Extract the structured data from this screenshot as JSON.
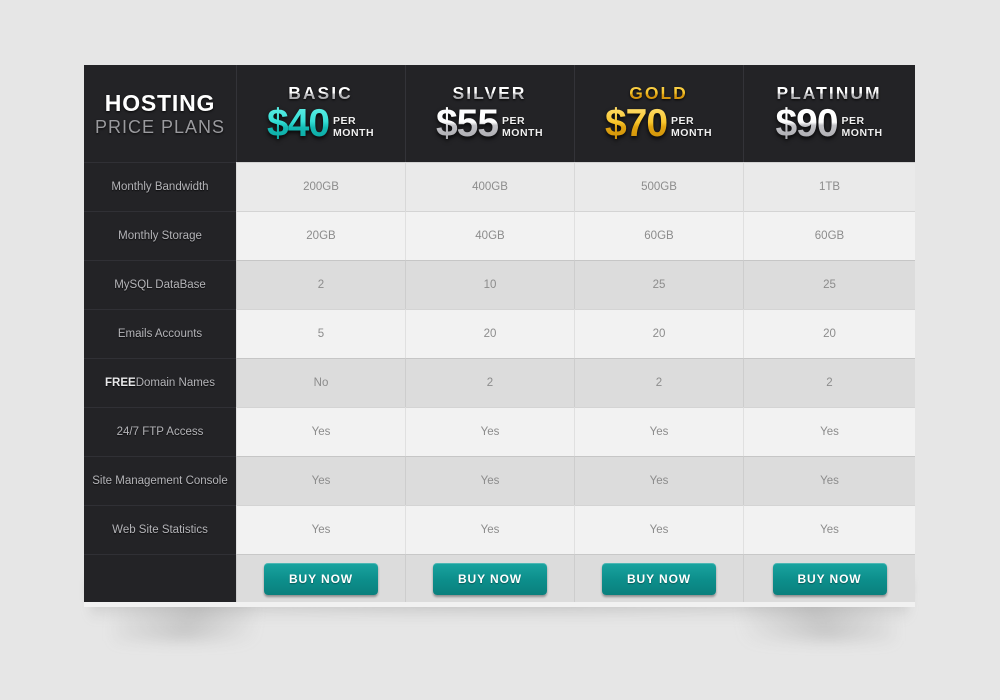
{
  "brand": {
    "line1": "HOSTING",
    "line2": "PRICE PLANS"
  },
  "colors": {
    "page_background": "#e6e6e6",
    "header_dark": "#232326",
    "feature_column_dark": "#232326",
    "row_light": "#f2f2f2",
    "row_dark": "#dcdcdc",
    "row_first": "#eaeaea",
    "accent_teal": "#13b9b3",
    "accent_gold": "#f5c32a",
    "accent_silver": "#c2c2c6",
    "button_teal": "#0d8f8c"
  },
  "plans": [
    {
      "name": "BASIC",
      "price": "$40",
      "per_line1": "PER",
      "per_line2": "MONTH",
      "name_style": "silver",
      "price_style": "teal",
      "buy_label": "BUY NOW"
    },
    {
      "name": "SILVER",
      "price": "$55",
      "per_line1": "PER",
      "per_line2": "MONTH",
      "name_style": "silver",
      "price_style": "silver",
      "buy_label": "BUY NOW"
    },
    {
      "name": "GOLD",
      "price": "$70",
      "per_line1": "PER",
      "per_line2": "MONTH",
      "name_style": "gold",
      "price_style": "gold",
      "buy_label": "BUY NOW"
    },
    {
      "name": "PLATINUM",
      "price": "$90",
      "per_line1": "PER",
      "per_line2": "MONTH",
      "name_style": "silver",
      "price_style": "silver",
      "buy_label": "BUY NOW"
    }
  ],
  "features": [
    {
      "label": "Monthly Bandwidth",
      "label_bold_prefix": "",
      "values": [
        "200GB",
        "400GB",
        "500GB",
        "1TB"
      ]
    },
    {
      "label": "Monthly Storage",
      "label_bold_prefix": "",
      "values": [
        "20GB",
        "40GB",
        "60GB",
        "60GB"
      ]
    },
    {
      "label": "MySQL DataBase",
      "label_bold_prefix": "",
      "values": [
        "2",
        "10",
        "25",
        "25"
      ]
    },
    {
      "label": "Emails Accounts",
      "label_bold_prefix": "",
      "values": [
        "5",
        "20",
        "20",
        "20"
      ]
    },
    {
      "label": " Domain Names",
      "label_bold_prefix": "FREE",
      "values": [
        "No",
        "2",
        "2",
        "2"
      ]
    },
    {
      "label": "24/7 FTP Access",
      "label_bold_prefix": "",
      "values": [
        "Yes",
        "Yes",
        "Yes",
        "Yes"
      ]
    },
    {
      "label": "Site Management Console",
      "label_bold_prefix": "",
      "values": [
        "Yes",
        "Yes",
        "Yes",
        "Yes"
      ]
    },
    {
      "label": "Web Site Statistics",
      "label_bold_prefix": "",
      "values": [
        "Yes",
        "Yes",
        "Yes",
        "Yes"
      ]
    }
  ]
}
